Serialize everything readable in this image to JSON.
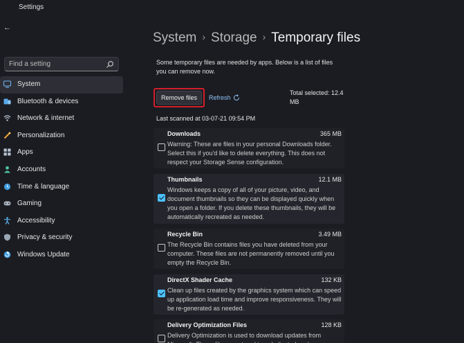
{
  "window": {
    "title": "Settings"
  },
  "search": {
    "placeholder": "Find a setting"
  },
  "sidebar": {
    "items": [
      {
        "label": "System",
        "icon": "system-icon",
        "active": true
      },
      {
        "label": "Bluetooth & devices",
        "icon": "bluetooth-icon"
      },
      {
        "label": "Network & internet",
        "icon": "network-icon"
      },
      {
        "label": "Personalization",
        "icon": "personalization-icon"
      },
      {
        "label": "Apps",
        "icon": "apps-icon"
      },
      {
        "label": "Accounts",
        "icon": "accounts-icon"
      },
      {
        "label": "Time & language",
        "icon": "time-language-icon"
      },
      {
        "label": "Gaming",
        "icon": "gaming-icon"
      },
      {
        "label": "Accessibility",
        "icon": "accessibility-icon"
      },
      {
        "label": "Privacy & security",
        "icon": "privacy-icon"
      },
      {
        "label": "Windows Update",
        "icon": "windows-update-icon"
      }
    ]
  },
  "breadcrumb": {
    "part1": "System",
    "part2": "Storage",
    "current": "Temporary files",
    "separator": "›"
  },
  "intro": "Some temporary files are needed by apps. Below is a list of files you can remove now.",
  "actions": {
    "remove_label": "Remove files",
    "refresh_label": "Refresh"
  },
  "total_selected": "Total selected: 12.4 MB",
  "last_scanned": "Last scanned at 03-07-21 09:54 PM",
  "files": [
    {
      "title": "Downloads",
      "size": "365 MB",
      "checked": false,
      "description": "Warning: These are files in your personal Downloads folder. Select this if you'd like to delete everything. This does not respect your Storage Sense configuration."
    },
    {
      "title": "Thumbnails",
      "size": "12.1 MB",
      "checked": true,
      "description": "Windows keeps a copy of all of your picture, video, and document thumbnails so they can be displayed quickly when you open a folder. If you delete these thumbnails, they will be automatically recreated as needed."
    },
    {
      "title": "Recycle Bin",
      "size": "3.49 MB",
      "checked": false,
      "description": "The Recycle Bin contains files you have deleted from your computer. These files are not permanently removed until you empty the Recycle Bin."
    },
    {
      "title": "DirectX Shader Cache",
      "size": "132 KB",
      "checked": true,
      "description": "Clean up files created by the graphics system which can speed up application load time and improve responsiveness. They will be re-generated as needed."
    },
    {
      "title": "Delivery Optimization Files",
      "size": "128 KB",
      "checked": false,
      "description": "Delivery Optimization is used to download updates from Microsoft. These files are stored in a dedicated cache"
    }
  ],
  "colors": {
    "background": "#1b1c22",
    "accent": "#4cc2ff",
    "highlight_box": "#d21f2b",
    "link": "#8fc3f5"
  }
}
